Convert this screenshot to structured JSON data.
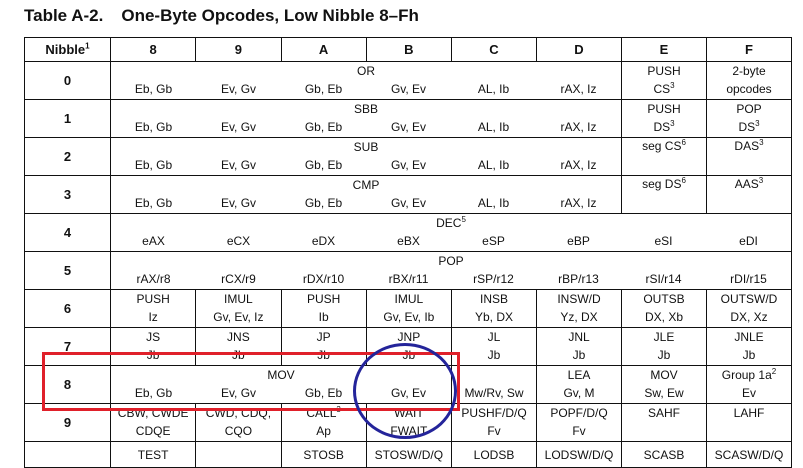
{
  "title": {
    "number": "Table A-2.",
    "text": "One-Byte Opcodes, Low Nibble 8–Fh"
  },
  "header": {
    "nibble": "Nibble",
    "nibble_sup": "1",
    "cols": [
      "8",
      "9",
      "A",
      "B",
      "C",
      "D",
      "E",
      "F"
    ]
  },
  "rows": [
    {
      "nibble": "0",
      "span_label": "OR",
      "span_sup": "",
      "cells": [
        "Eb, Gb",
        "Ev, Gv",
        "Gb, Eb",
        "Gv, Ev",
        "AL, Ib",
        "rAX, Iz"
      ],
      "e_top": "PUSH",
      "e_bot": "CS",
      "e_bot_sup": "3",
      "f_top": "2-byte",
      "f_bot": "opcodes",
      "f_top_sup": "",
      "f_bot_sup": ""
    },
    {
      "nibble": "1",
      "span_label": "SBB",
      "span_sup": "",
      "cells": [
        "Eb, Gb",
        "Ev, Gv",
        "Gb, Eb",
        "Gv, Ev",
        "AL, Ib",
        "rAX, Iz"
      ],
      "e_top": "PUSH",
      "e_bot": "DS",
      "e_bot_sup": "3",
      "f_top": "POP",
      "f_bot": "DS",
      "f_top_sup": "",
      "f_bot_sup": "3"
    },
    {
      "nibble": "2",
      "span_label": "SUB",
      "span_sup": "",
      "cells": [
        "Eb, Gb",
        "Ev, Gv",
        "Gb, Eb",
        "Gv, Ev",
        "AL, Ib",
        "rAX, Iz"
      ],
      "e_top": "seg CS",
      "e_bot": "",
      "e_top_sup": "6",
      "e_bot_sup": "",
      "f_top": "DAS",
      "f_bot": "",
      "f_top_sup": "3",
      "f_bot_sup": ""
    },
    {
      "nibble": "3",
      "span_label": "CMP",
      "span_sup": "",
      "cells": [
        "Eb, Gb",
        "Ev, Gv",
        "Gb, Eb",
        "Gv, Ev",
        "AL, Ib",
        "rAX, Iz"
      ],
      "e_top": "seg DS",
      "e_bot": "",
      "e_top_sup": "6",
      "e_bot_sup": "",
      "f_top": "AAS",
      "f_bot": "",
      "f_top_sup": "3",
      "f_bot_sup": ""
    },
    {
      "nibble": "4",
      "span_label": "DEC",
      "span_sup": "5",
      "cells": [
        "eAX",
        "eCX",
        "eDX",
        "eBX",
        "eSP",
        "eBP",
        "eSI",
        "eDI"
      ]
    },
    {
      "nibble": "5",
      "span_label": "POP",
      "span_sup": "",
      "cells": [
        "rAX/r8",
        "rCX/r9",
        "rDX/r10",
        "rBX/r11",
        "rSP/r12",
        "rBP/r13",
        "rSI/r14",
        "rDI/r15"
      ]
    },
    {
      "nibble": "6",
      "tops": [
        "PUSH",
        "IMUL",
        "PUSH",
        "IMUL",
        "INSB",
        "INSW/D",
        "OUTSB",
        "OUTSW/D"
      ],
      "bots": [
        "Iz",
        "Gv, Ev, Iz",
        "Ib",
        "Gv, Ev, Ib",
        "Yb, DX",
        "Yz, DX",
        "DX, Xb",
        "DX, Xz"
      ]
    },
    {
      "nibble": "7",
      "tops": [
        "JS",
        "JNS",
        "JP",
        "JNP",
        "JL",
        "JNL",
        "JLE",
        "JNLE"
      ],
      "bots": [
        "Jb",
        "Jb",
        "Jb",
        "Jb",
        "Jb",
        "Jb",
        "Jb",
        "Jb"
      ]
    },
    {
      "nibble": "8",
      "span_label": "MOV",
      "cells": [
        "Eb, Gb",
        "Ev, Gv",
        "Gb, Eb",
        "Gv, Ev"
      ],
      "c_top": "",
      "c_bot": "Mw/Rv, Sw",
      "d_top": "LEA",
      "d_bot": "Gv, M",
      "e_top": "MOV",
      "e_bot": "Sw, Ew",
      "f_top": "Group 1a",
      "f_top_sup": "2",
      "f_bot": "Ev"
    },
    {
      "nibble": "9",
      "tops": [
        "CBW, CWDE",
        "CWD, CDQ,",
        "CALL",
        "WAIT",
        "PUSHF/D/Q",
        "POPF/D/Q",
        "SAHF",
        "LAHF"
      ],
      "tops_sup": [
        "",
        "",
        "3",
        "",
        "",
        "",
        "",
        ""
      ],
      "bots": [
        "CDQE",
        "CQO",
        "Ap",
        "FWAIT",
        "Fv",
        "Fv",
        "",
        ""
      ]
    },
    {
      "nibble": "",
      "tops": [
        "",
        "TEST",
        "",
        "STOSB",
        "STOSW/D/Q",
        "LODSB",
        "LODSW/D/Q",
        "SCASB",
        "SCASW/D/Q"
      ]
    }
  ]
}
